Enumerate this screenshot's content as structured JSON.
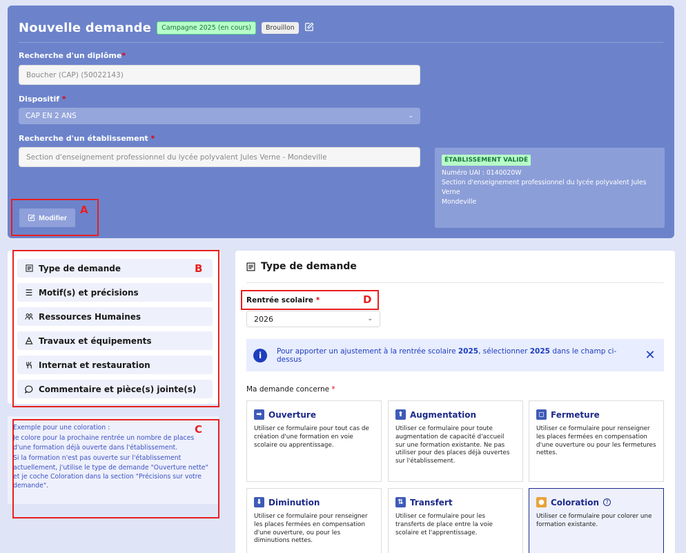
{
  "header": {
    "title": "Nouvelle demande",
    "campaign_badge": "Campagne 2025 (en cours)",
    "status_badge": "Brouillon",
    "diplome_label": "Recherche d'un diplôme",
    "diplome_value": "Boucher (CAP) (50022143)",
    "dispositif_label": "Dispositif",
    "dispositif_value": "CAP EN 2 ANS",
    "etab_label": "Recherche d'un établissement",
    "etab_value": "Section d'enseignement professionnel du lycée polyvalent Jules Verne - Mondeville",
    "modify_label": "Modifier"
  },
  "etablissement": {
    "badge": "ÉTABLISSEMENT VALIDÉ",
    "uai": "Numéro UAI : 0140020W",
    "name": "Section d'enseignement professionnel du lycée polyvalent Jules Verne",
    "city": "Mondeville"
  },
  "annotations": [
    "A",
    "B",
    "C",
    "D"
  ],
  "sidebar": {
    "items": [
      {
        "label": "Type de demande",
        "icon": "list-icon"
      },
      {
        "label": "Motif(s) et précisions",
        "icon": "bullet-list-icon"
      },
      {
        "label": "Ressources Humaines",
        "icon": "people-icon"
      },
      {
        "label": "Travaux et équipements",
        "icon": "tools-icon"
      },
      {
        "label": "Internat et restauration",
        "icon": "cutlery-icon"
      },
      {
        "label": "Commentaire et pièce(s) jointe(s)",
        "icon": "comment-icon"
      }
    ]
  },
  "example": {
    "title": "Exemple pour une coloration :",
    "p1": "Je colore pour la prochaine rentrée un nombre de places d'une formation déjà ouverte dans l'établissement.",
    "p2": "Si la formation n'est pas ouverte sur l'établissement actuellement, j'utilise le type de demande \"Ouverture nette\" et je coche Coloration dans la section \"Précisions sur votre demande\"."
  },
  "panel": {
    "title": "Type de demande",
    "rentree_label": "Rentrée scolaire",
    "rentree_value": "2026",
    "info_pre": "Pour apporter un ajustement à la rentrée scolaire ",
    "info_year1": "2025",
    "info_mid": ", sélectionner ",
    "info_year2": "2025",
    "info_post": " dans le champ ci-dessus",
    "concern_label": "Ma demande concerne",
    "cards": [
      {
        "title": "Ouverture",
        "icon": "arrow-right-icon",
        "desc": "Utiliser ce formulaire pour tout cas de création d'une formation en voie scolaire ou apprentissage."
      },
      {
        "title": "Augmentation",
        "icon": "arrow-up-icon",
        "desc": "Utiliser ce formulaire pour toute augmentation de capacité d'accueil sur une formation existante. Ne pas utiliser pour des places déjà ouvertes sur l'établissement."
      },
      {
        "title": "Fermeture",
        "icon": "square-icon",
        "desc": "Utiliser ce formulaire pour renseigner les places fermées en compensation d'une ouverture ou pour les fermetures nettes."
      },
      {
        "title": "Diminution",
        "icon": "arrow-down-icon",
        "desc": "Utiliser ce formulaire pour renseigner les places fermées en compensation d'une ouverture, ou pour les diminutions nettes."
      },
      {
        "title": "Transfert",
        "icon": "swap-icon",
        "desc": "Utiliser ce formulaire pour les transferts de place entre la voie scolaire et l'apprentissage."
      },
      {
        "title": "Coloration",
        "icon": "palette-icon",
        "desc": "Utiliser ce formulaire pour colorer une formation existante."
      }
    ]
  }
}
